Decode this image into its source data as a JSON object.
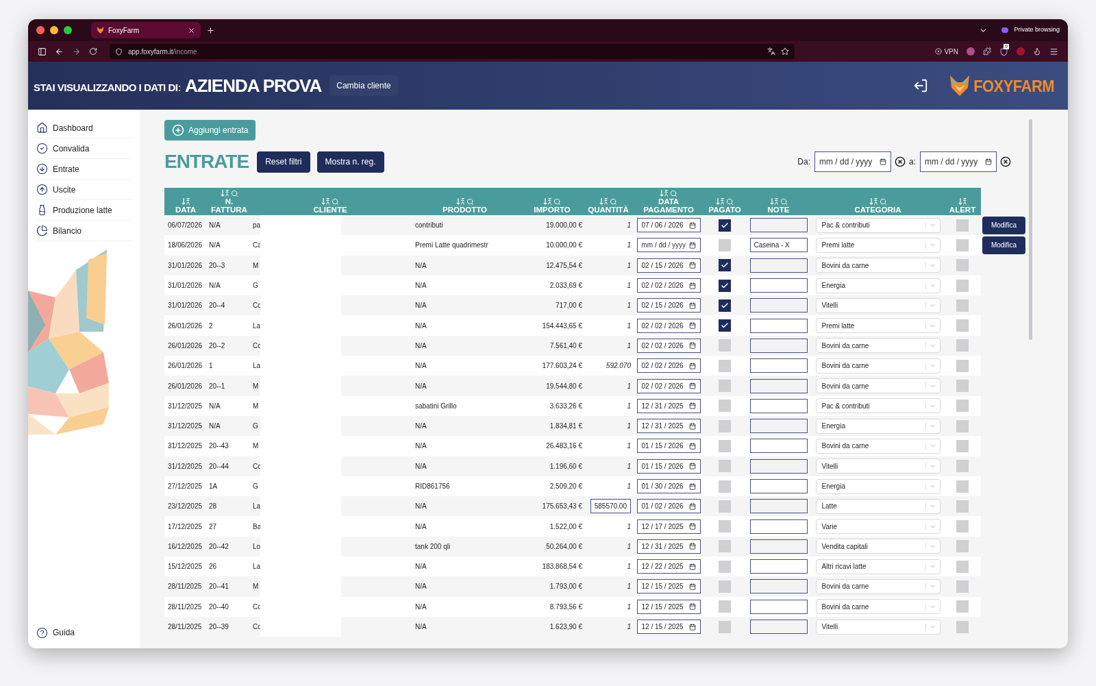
{
  "browser": {
    "tab_title": "FoxyFarm",
    "url_host": "app.foxyfarm.it",
    "url_path": "/income",
    "private_label": "Private browsing",
    "vpn_label": "VPN",
    "extension_badge": "9"
  },
  "header": {
    "prefix": "STAI VISUALIZZANDO I DATI DI:",
    "company": "AZIENDA PROVA",
    "change_button": "Cambia cliente",
    "brand": "FOXYFARM"
  },
  "sidebar": {
    "items": [
      {
        "label": "Dashboard"
      },
      {
        "label": "Convalida"
      },
      {
        "label": "Entrate"
      },
      {
        "label": "Uscite"
      },
      {
        "label": "Produzione latte"
      },
      {
        "label": "Bilancio"
      }
    ],
    "help": "Guida"
  },
  "add_button": "Aggiungi entrata",
  "title": "ENTRATE",
  "filter_buttons": [
    "Reset filtri",
    "Mostra n. reg."
  ],
  "date_filter": {
    "from_label": "Da:",
    "from_placeholder": "mm / dd / yyyy",
    "to_label": "a:",
    "to_placeholder": "mm / dd / yyyy"
  },
  "table": {
    "columns": [
      {
        "label": "DATA",
        "searchable": false
      },
      {
        "label": "N. FATTURA",
        "searchable": true
      },
      {
        "label": "CLIENTE",
        "searchable": true
      },
      {
        "label": "PRODOTTO",
        "searchable": true
      },
      {
        "label": "IMPORTO",
        "searchable": true
      },
      {
        "label": "QUANTITÀ",
        "searchable": true
      },
      {
        "label": "DATA PAGAMENTO",
        "searchable": true
      },
      {
        "label": "PAGATO",
        "searchable": true
      },
      {
        "label": "NOTE",
        "searchable": true
      },
      {
        "label": "CATEGORIA",
        "searchable": true
      },
      {
        "label": "ALERT",
        "searchable": false
      }
    ],
    "rows": [
      {
        "data": "06/07/2026",
        "fattura": "N/A",
        "cliente": "pa",
        "prodotto": "contributi",
        "importo": "19.000,00 €",
        "quantity": {
          "kind": "text",
          "value": "1"
        },
        "pagamento": "07 / 06 / 2026",
        "pagato": true,
        "categoria": "Pac & contributi",
        "alert": false,
        "action": "Modifica"
      },
      {
        "data": "18/06/2026",
        "fattura": "N/A",
        "cliente": "Ca",
        "prodotto": "Premi Latte quadrimestr",
        "importo": "10.000,00 €",
        "quantity": {
          "kind": "text",
          "value": "1"
        },
        "pagamento_placeholder": "mm / dd / yyyy",
        "pagato": false,
        "note": "Caseina - X",
        "categoria": "Premi latte",
        "alert": false,
        "action": "Modifica"
      },
      {
        "data": "31/01/2026",
        "fattura": "20--3",
        "cliente": "M",
        "prodotto": "N/A",
        "importo": "12.475,54 €",
        "quantity": {
          "kind": "text",
          "value": "1"
        },
        "pagamento": "02 / 15 / 2026",
        "pagato": true,
        "categoria": "Bovini da carne",
        "alert": false
      },
      {
        "data": "31/01/2026",
        "fattura": "N/A",
        "cliente": "G",
        "prodotto": "N/A",
        "importo": "2.033,69 €",
        "quantity": {
          "kind": "text",
          "value": "1"
        },
        "pagamento": "02 / 02 / 2026",
        "pagato": true,
        "categoria": "Energia",
        "alert": false
      },
      {
        "data": "31/01/2026",
        "fattura": "20--4",
        "cliente": "Co",
        "prodotto": "N/A",
        "importo": "717,00 €",
        "quantity": {
          "kind": "text",
          "value": "1"
        },
        "pagamento": "02 / 15 / 2026",
        "pagato": true,
        "categoria": "Vitelli",
        "alert": false
      },
      {
        "data": "26/01/2026",
        "fattura": "2",
        "cliente": "La",
        "prodotto": "N/A",
        "importo": "154.443,65 €",
        "quantity": {
          "kind": "text",
          "value": "1"
        },
        "pagamento": "02 / 02 / 2026",
        "pagato": true,
        "categoria": "Premi latte",
        "alert": false
      },
      {
        "data": "26/01/2026",
        "fattura": "20--2",
        "cliente": "Co",
        "prodotto": "N/A",
        "importo": "7.561,40 €",
        "quantity": {
          "kind": "text",
          "value": "1"
        },
        "pagamento": "02 / 02 / 2026",
        "pagato": false,
        "categoria": "Bovini da carne",
        "alert": false
      },
      {
        "data": "26/01/2026",
        "fattura": "1",
        "cliente": "La",
        "prodotto": "N/A",
        "importo": "177.603,24 €",
        "quantity": {
          "kind": "text",
          "value": "592.070"
        },
        "pagamento": "02 / 02 / 2026",
        "pagato": false,
        "categoria": "Bovini da carne",
        "alert": false
      },
      {
        "data": "26/01/2026",
        "fattura": "20--1",
        "cliente": "M",
        "prodotto": "N/A",
        "importo": "19.544,80 €",
        "quantity": {
          "kind": "text",
          "value": "1"
        },
        "pagamento": "02 / 02 / 2026",
        "pagato": false,
        "categoria": "Bovini da carne",
        "alert": false
      },
      {
        "data": "31/12/2025",
        "fattura": "N/A",
        "cliente": "M",
        "prodotto": "sabatini Grillo",
        "importo": "3.633,26 €",
        "quantity": {
          "kind": "text",
          "value": "1"
        },
        "pagamento": "12 / 31 / 2025",
        "pagato": false,
        "categoria": "Pac & contributi",
        "alert": false
      },
      {
        "data": "31/12/2025",
        "fattura": "N/A",
        "cliente": "G",
        "prodotto": "N/A",
        "importo": "1.834,81 €",
        "quantity": {
          "kind": "text",
          "value": "1"
        },
        "pagamento": "12 / 31 / 2025",
        "pagato": false,
        "categoria": "Energia",
        "alert": false
      },
      {
        "data": "31/12/2025",
        "fattura": "20--43",
        "cliente": "M",
        "prodotto": "N/A",
        "importo": "26.483,16 €",
        "quantity": {
          "kind": "text",
          "value": "1"
        },
        "pagamento": "01 / 15 / 2026",
        "pagato": false,
        "categoria": "Bovini da carne",
        "alert": false
      },
      {
        "data": "31/12/2025",
        "fattura": "20--44",
        "cliente": "Co",
        "prodotto": "N/A",
        "importo": "1.196,60 €",
        "quantity": {
          "kind": "text",
          "value": "1"
        },
        "pagamento": "01 / 15 / 2026",
        "pagato": false,
        "categoria": "Vitelli",
        "alert": false
      },
      {
        "data": "27/12/2025",
        "fattura": "1A",
        "cliente": "G",
        "prodotto": "RID861756",
        "importo": "2.509,20 €",
        "quantity": {
          "kind": "text",
          "value": "1"
        },
        "pagamento": "01 / 30 / 2026",
        "pagato": false,
        "categoria": "Energia",
        "alert": false
      },
      {
        "data": "23/12/2025",
        "fattura": "28",
        "cliente": "La",
        "prodotto": "N/A",
        "importo": "175.653,43 €",
        "quantity": {
          "kind": "input",
          "value": "585570.00"
        },
        "pagamento": "01 / 02 / 2026",
        "pagato": false,
        "categoria": "Latte",
        "alert": false
      },
      {
        "data": "17/12/2025",
        "fattura": "27",
        "cliente": "Ba",
        "prodotto": "N/A",
        "importo": "1.522,00 €",
        "quantity": {
          "kind": "text",
          "value": "1"
        },
        "pagamento": "12 / 17 / 2025",
        "pagato": false,
        "categoria": "Varie",
        "alert": false
      },
      {
        "data": "16/12/2025",
        "fattura": "20--42",
        "cliente": "Lo",
        "prodotto": "tank 200 qli",
        "importo": "50.264,00 €",
        "quantity": {
          "kind": "text",
          "value": "1"
        },
        "pagamento": "12 / 31 / 2025",
        "pagato": false,
        "categoria": "Vendita capitali",
        "alert": false
      },
      {
        "data": "15/12/2025",
        "fattura": "26",
        "cliente": "La",
        "prodotto": "N/A",
        "importo": "183.868,54 €",
        "quantity": {
          "kind": "text",
          "value": "1"
        },
        "pagamento": "12 / 22 / 2025",
        "pagato": false,
        "categoria": "Altri ricavi latte",
        "alert": false
      },
      {
        "data": "28/11/2025",
        "fattura": "20--41",
        "cliente": "M",
        "prodotto": "N/A",
        "importo": "1.793,00 €",
        "quantity": {
          "kind": "text",
          "value": "1"
        },
        "pagamento": "12 / 15 / 2025",
        "pagato": false,
        "categoria": "Bovini da carne",
        "alert": false
      },
      {
        "data": "28/11/2025",
        "fattura": "20--40",
        "cliente": "Co",
        "prodotto": "N/A",
        "importo": "8.793,56 €",
        "quantity": {
          "kind": "text",
          "value": "1"
        },
        "pagamento": "12 / 15 / 2025",
        "pagato": false,
        "categoria": "Bovini da carne",
        "alert": false
      },
      {
        "data": "28/11/2025",
        "fattura": "20--39",
        "cliente": "Co",
        "prodotto": "N/A",
        "importo": "1.623,90 €",
        "quantity": {
          "kind": "text",
          "value": "1"
        },
        "pagamento": "12 / 15 / 2025",
        "pagato": false,
        "categoria": "Vitelli",
        "alert": false
      }
    ]
  }
}
